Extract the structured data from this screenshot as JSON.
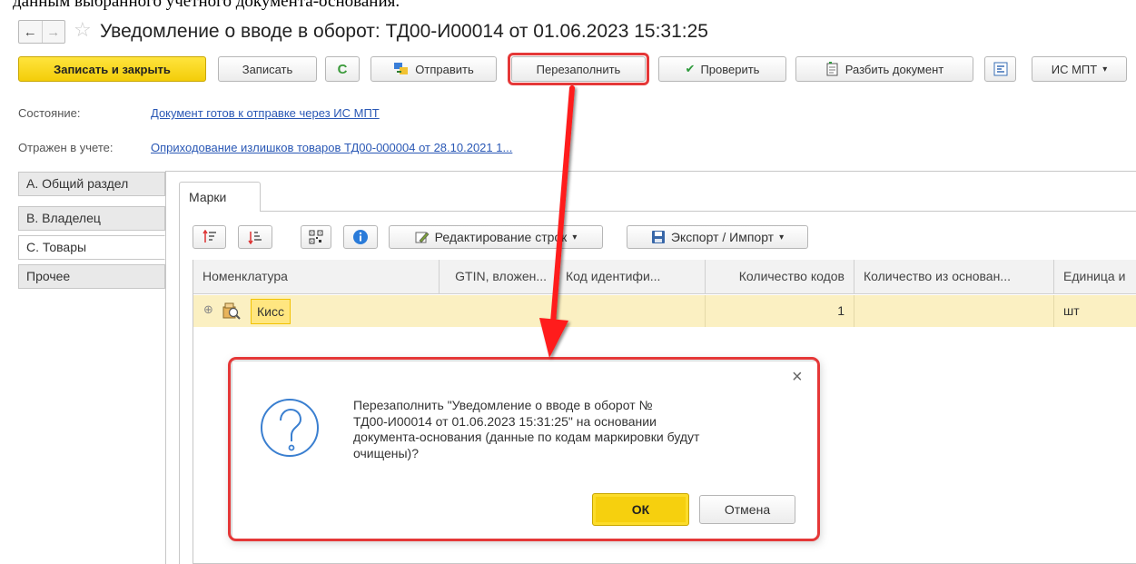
{
  "caption_top": "данным выбранного учетного документа-основания.",
  "nav": {
    "back_glyph": "←",
    "forward_glyph": "→"
  },
  "window": {
    "title": "Уведомление о вводе в оборот:  ТД00-И00014 от 01.06.2023 15:31:25"
  },
  "toolbar": {
    "save_close": "Записать и закрыть",
    "save": "Записать",
    "refresh_icon": "C",
    "send": "Отправить",
    "refill": "Перезаполнить",
    "check": "Проверить",
    "split": "Разбить документ",
    "ismpt": "ИС МПТ"
  },
  "fields": {
    "state_label": "Состояние:",
    "state_link": "Документ готов к отправке через ИС МПТ",
    "reflected_label": "Отражен в учете:",
    "reflected_link": "Оприходование излишков товаров ТД00-000004 от 28.10.2021 1..."
  },
  "side_tabs": [
    {
      "label": "А. Общий раздел"
    },
    {
      "label": "В. Владелец"
    },
    {
      "label": "С. Товары"
    },
    {
      "label": "Прочее"
    }
  ],
  "inner_tab": "Марки",
  "table_toolbar": {
    "edit_rows": "Редактирование строк",
    "export_import": "Экспорт / Импорт"
  },
  "table": {
    "columns": [
      "Номенклатура",
      "GTIN, вложен...",
      "Код идентифи...",
      "Количество кодов",
      "Количество из основан...",
      "Единица и"
    ],
    "rows": [
      {
        "item": "Кисс",
        "gtin": "",
        "code": "",
        "qty_codes": "1",
        "qty_base": "",
        "unit": "шт"
      }
    ]
  },
  "dialog": {
    "close": "×",
    "message_lines": [
      "Перезаполнить \"Уведомление о вводе в оборот №",
      "ТД00-И00014 от 01.06.2023 15:31:25\" на основании",
      "документа-основания (данные по кодам маркировки будут",
      "очищены)?"
    ],
    "ok": "ОК",
    "cancel": "Отмена"
  },
  "colors": {
    "accent_yellow": "#f6d00e",
    "highlight_red": "#e53838",
    "link_blue": "#2a58b5",
    "row_highlight": "#fbf0c2"
  },
  "icons": [
    "back-arrow-icon",
    "forward-arrow-icon",
    "favorite-star-icon",
    "refresh-icon",
    "send-icon",
    "check-icon",
    "split-document-icon",
    "structure-icon",
    "sort-asc-icon",
    "sort-desc-icon",
    "qr-code-icon",
    "info-icon",
    "edit-icon",
    "save-export-icon",
    "expand-icon",
    "item-icon",
    "question-icon",
    "close-icon"
  ]
}
